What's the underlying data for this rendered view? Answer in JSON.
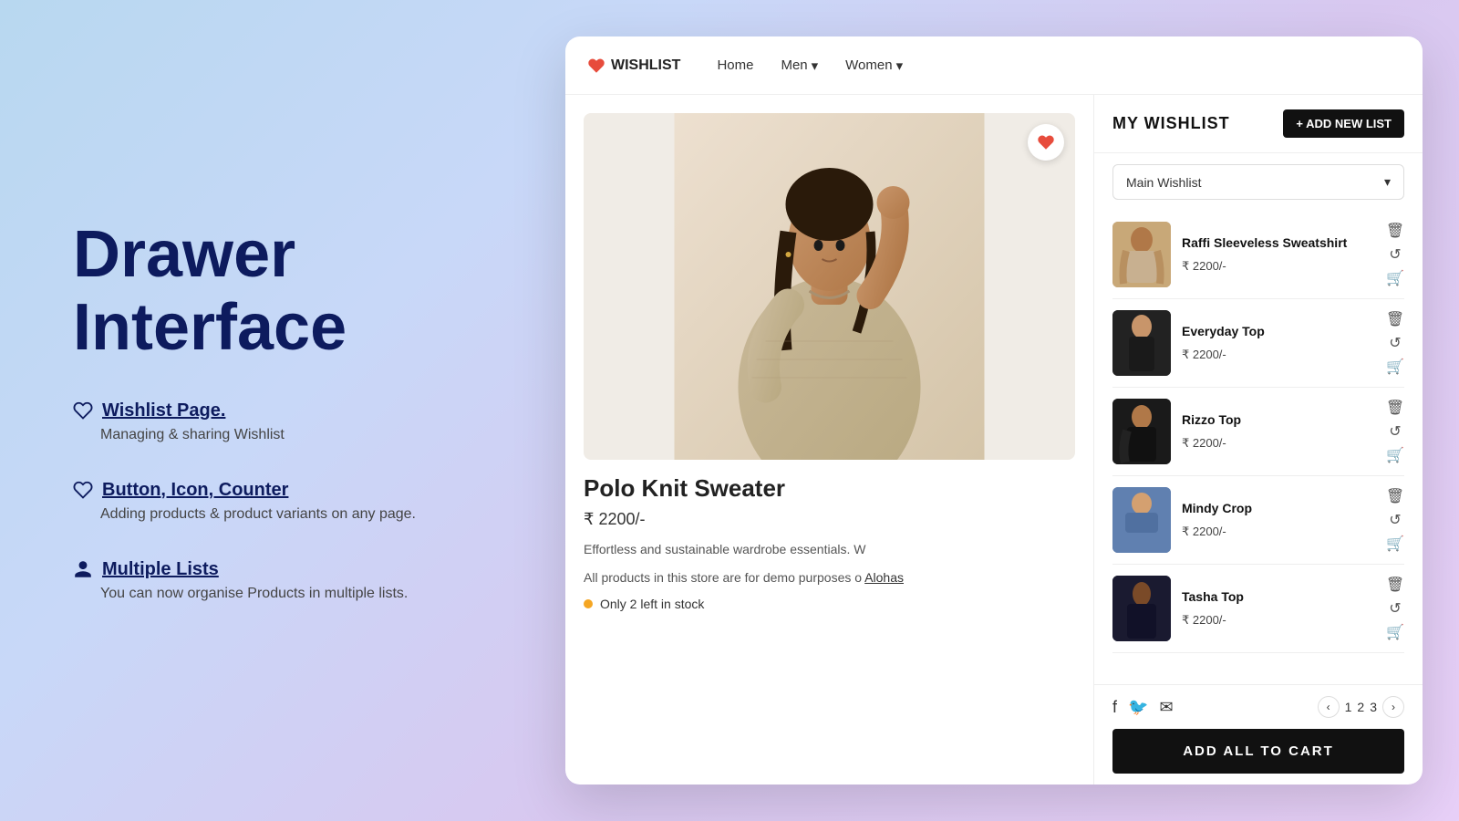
{
  "background": {
    "gradient": "135deg, #b8d8f0 0%, #c8d8f8 30%, #d8c8f0 60%, #e8d0f8 100%"
  },
  "left_panel": {
    "main_title_line1": "Drawer",
    "main_title_line2": "Interface",
    "features": [
      {
        "icon": "heart",
        "title": "Wishlist Page.",
        "description": "Managing & sharing Wishlist"
      },
      {
        "icon": "heart",
        "title": "Button, Icon, Counter",
        "description": "Adding products & product variants on any page."
      },
      {
        "icon": "person",
        "title": "Multiple Lists",
        "description": "You can now organise Products in multiple lists."
      }
    ]
  },
  "nav": {
    "logo": "WISHLIST",
    "links": [
      {
        "label": "Home",
        "has_dropdown": false
      },
      {
        "label": "Men",
        "has_dropdown": true
      },
      {
        "label": "Women",
        "has_dropdown": true
      }
    ]
  },
  "product": {
    "title": "Polo Knit Sweater",
    "price": "₹ 2200/-",
    "description": "Effortless and sustainable wardrobe essentials. W",
    "note": "All products in this store are for demo purposes o",
    "brand": "Alohas",
    "stock": "Only 2 left in stock",
    "wishlisted": true
  },
  "wishlist": {
    "panel_title": "MY WISHLIST",
    "add_new_label": "+ ADD NEW LIST",
    "select_label": "Main Wishlist",
    "items": [
      {
        "name": "Raffi Sleeveless Sweatshirt",
        "price": "₹ 2200/-",
        "img_class": "img-raffi"
      },
      {
        "name": "Everyday Top",
        "price": "₹ 2200/-",
        "img_class": "img-everyday"
      },
      {
        "name": "Rizzo Top",
        "price": "₹ 2200/-",
        "img_class": "img-rizzo"
      },
      {
        "name": "Mindy Crop",
        "price": "₹ 2200/-",
        "img_class": "img-mindy"
      },
      {
        "name": "Tasha Top",
        "price": "₹ 2200/-",
        "img_class": "img-tasha"
      }
    ],
    "pagination": {
      "current": 1,
      "pages": [
        "1",
        "2",
        "3"
      ]
    },
    "add_all_label": "ADD ALL TO  CART",
    "social": [
      "f",
      "t",
      "✉"
    ]
  }
}
